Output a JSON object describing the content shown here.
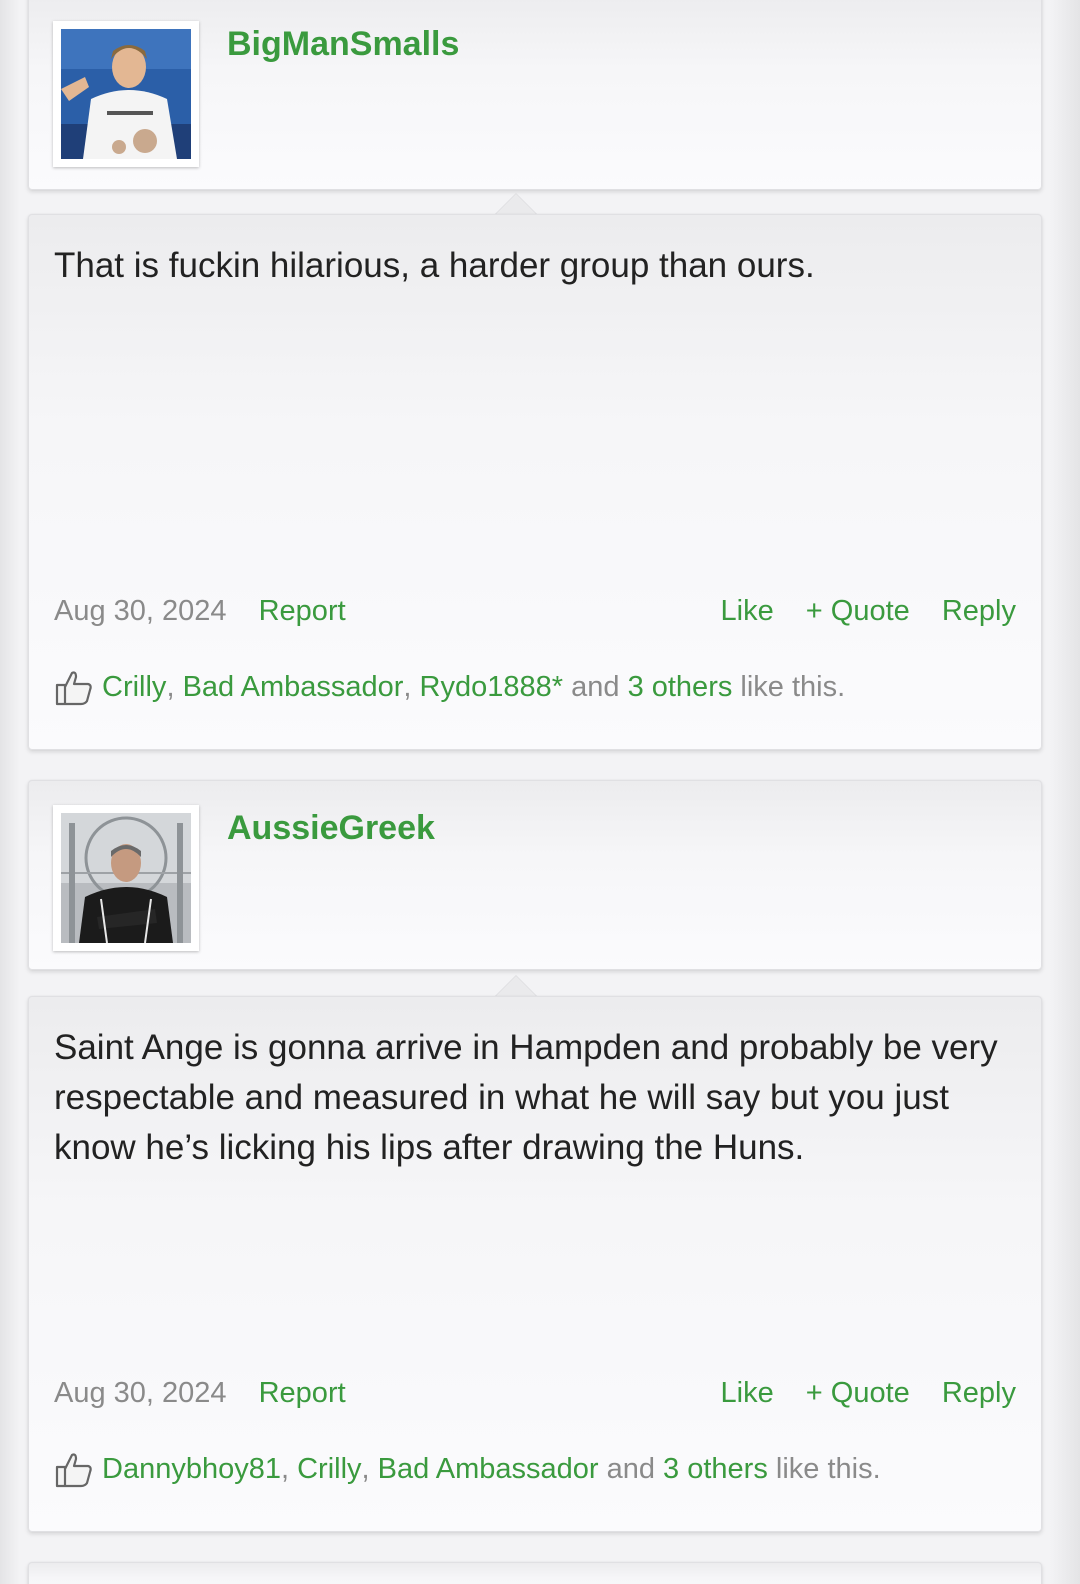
{
  "posts": [
    {
      "username": "BigManSmalls",
      "avatar": "user-avatar-photo",
      "message": "That is fuckin hilarious, a harder group than ours.",
      "date": "Aug 30, 2024",
      "report": "Report",
      "like": "Like",
      "quote": "+ Quote",
      "reply": "Reply",
      "likers": [
        "Crilly",
        "Bad Ambassador",
        "Rydo1888*"
      ],
      "and_text": "and",
      "others": "3 others",
      "like_this": "like this."
    },
    {
      "username": "AussieGreek",
      "avatar": "user-avatar-photo",
      "message": "Saint Ange is gonna arrive in Hampden and probably be very respectable and measured in what he will say but you just know he’s licking his lips after drawing the Huns.",
      "date": "Aug 30, 2024",
      "report": "Report",
      "like": "Like",
      "quote": "+ Quote",
      "reply": "Reply",
      "likers": [
        "Dannybhoy81",
        "Crilly",
        "Bad Ambassador"
      ],
      "and_text": "and",
      "others": "3 others",
      "like_this": "like this."
    }
  ],
  "colors": {
    "accent": "#3a9a3e",
    "muted": "#8a8a8a",
    "text": "#222222"
  }
}
